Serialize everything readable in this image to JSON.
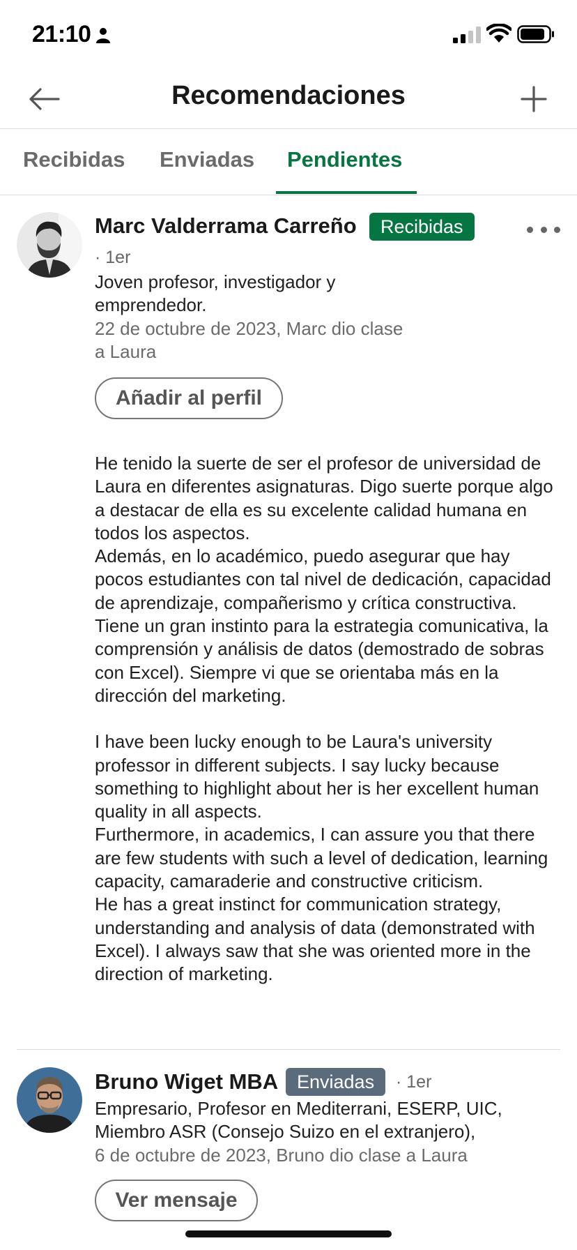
{
  "status_bar": {
    "time": "21:10",
    "icons": [
      "person-icon",
      "signal-icon",
      "wifi-icon",
      "battery-icon"
    ]
  },
  "header": {
    "title": "Recomendaciones",
    "back_icon": "arrow-left-icon",
    "add_icon": "plus-icon"
  },
  "tabs": [
    {
      "label": "Recibidas",
      "active": false
    },
    {
      "label": "Enviadas",
      "active": false
    },
    {
      "label": "Pendientes",
      "active": true
    }
  ],
  "recommendations": [
    {
      "name": "Marc Valderrama Carreño",
      "badge": "Recibidas",
      "degree": "· 1er",
      "headline_lines": [
        "Joven profesor, investigador y",
        "emprendedor."
      ],
      "date_lines": [
        "22 de octubre de 2023, Marc dio clase",
        "a Laura"
      ],
      "action_label": "Añadir al perfil",
      "paragraphs": [
        "He tenido la suerte de ser el profesor de universidad de Laura en diferentes asignaturas. Digo suerte porque algo a destacar de ella es su excelente calidad humana en todos los aspectos.",
        "Además, en lo académico, puedo asegurar que hay pocos estudiantes con tal nivel de dedicación, capacidad de aprendizaje, compañerismo y crítica constructiva.",
        "Tiene un gran instinto para la estrategia comunicativa, la comprensión y análisis de datos (demostrado de sobras con Excel). Siempre vi que se orientaba más en la dirección del marketing.",
        "",
        "I have been lucky enough to be Laura's university professor in different subjects. I say lucky because something to highlight about her is her excellent human quality in all aspects.",
        "Furthermore, in academics, I can assure you that there are few students with such a level of dedication, learning capacity, camaraderie and constructive criticism.",
        "He has a great instinct for communication strategy, understanding and analysis of data (demonstrated with Excel). I always saw that she was oriented more in the direction of marketing."
      ]
    },
    {
      "name": "Bruno Wiget MBA",
      "badge": "Enviadas",
      "degree": "· 1er",
      "headline_lines": [
        "Empresario, Profesor en Mediterrani, ESERP, UIC,",
        "Miembro ASR (Consejo Suizo en el extranjero),"
      ],
      "date_lines": [
        "6 de octubre de 2023, Bruno dio clase a Laura"
      ],
      "action_label": "Ver mensaje"
    }
  ],
  "colors": {
    "accent_green": "#057642",
    "badge_gray": "#5a6b7b",
    "secondary_text": "#6b6b6b"
  }
}
